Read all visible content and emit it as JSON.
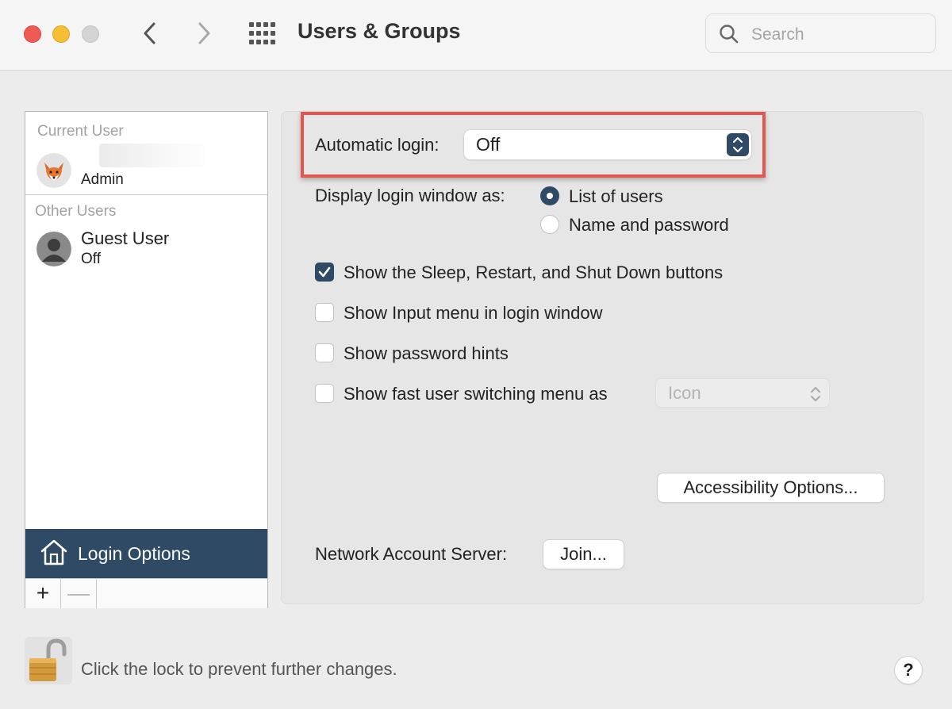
{
  "window": {
    "title": "Users & Groups",
    "search_placeholder": "Search"
  },
  "sidebar": {
    "current_user_label": "Current User",
    "current_user": {
      "role": "Admin",
      "avatar": "fox-avatar"
    },
    "other_users_label": "Other Users",
    "other_users": [
      {
        "name": "Guest User",
        "status": "Off",
        "avatar": "person-silhouette"
      }
    ],
    "login_options_label": "Login Options",
    "add_label": "+",
    "remove_label": "—"
  },
  "login_options": {
    "automatic_login_label": "Automatic login:",
    "automatic_login_value": "Off",
    "display_login_label": "Display login window as:",
    "display_options": [
      {
        "label": "List of users",
        "selected": true
      },
      {
        "label": "Name and password",
        "selected": false
      }
    ],
    "checkboxes": [
      {
        "label": "Show the Sleep, Restart, and Shut Down buttons",
        "checked": true
      },
      {
        "label": "Show Input menu in login window",
        "checked": false
      },
      {
        "label": "Show password hints",
        "checked": false
      },
      {
        "label": "Show fast user switching menu as",
        "checked": false
      }
    ],
    "fast_switch_value": "Icon",
    "accessibility_button": "Accessibility Options...",
    "network_server_label": "Network Account Server:",
    "join_button": "Join..."
  },
  "footer": {
    "lock_text": "Click the lock to prevent further changes.",
    "help_label": "?"
  },
  "colors": {
    "accent": "#2e4a64",
    "highlight_border": "#e2564f"
  }
}
